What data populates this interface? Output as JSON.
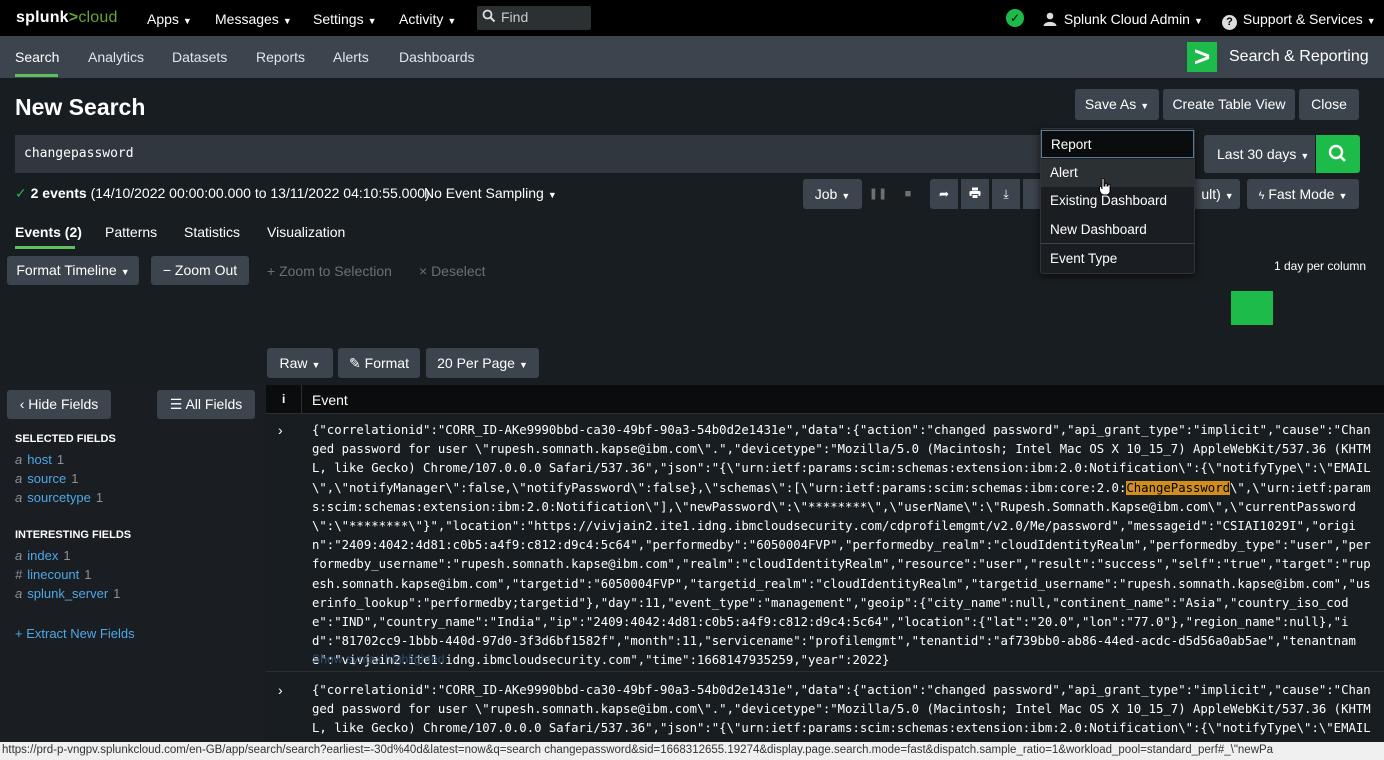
{
  "topbar": {
    "logo_prefix": "splunk",
    "logo_gt": ">",
    "logo_suffix": "cloud",
    "menus": [
      "Apps",
      "Messages",
      "Settings",
      "Activity"
    ],
    "find_placeholder": "Find",
    "user": "Splunk Cloud Admin",
    "support": "Support & Services"
  },
  "appbar": {
    "tabs": [
      "Search",
      "Analytics",
      "Datasets",
      "Reports",
      "Alerts",
      "Dashboards"
    ],
    "active_tab": "Search",
    "app_name": "Search & Reporting",
    "app_icon": ">"
  },
  "page": {
    "title": "New Search",
    "save_as": "Save As",
    "create_table": "Create Table View",
    "close": "Close"
  },
  "search": {
    "query": "changepassword",
    "time_range": "Last 30 days"
  },
  "status": {
    "count_text": "2 events",
    "range_text": "(14/10/2022 00:00:00.000 to 13/11/2022 04:10:55.000)",
    "sampling": "No Event Sampling",
    "job": "Job",
    "mode_partial": "ult)",
    "fast_mode": "Fast Mode"
  },
  "result_tabs": [
    "Events (2)",
    "Patterns",
    "Statistics",
    "Visualization"
  ],
  "timeline": {
    "format": "Format Timeline",
    "zoom_out": "Zoom Out",
    "zoom_sel": "+ Zoom to Selection",
    "deselect": "× Deselect",
    "per_column": "1 day per column"
  },
  "event_controls": {
    "raw": "Raw",
    "format": "Format",
    "per_page": "20 Per Page"
  },
  "sidebar": {
    "hide_fields": "Hide Fields",
    "all_fields": "All Fields",
    "selected_title": "SELECTED FIELDS",
    "selected": [
      {
        "type": "a",
        "name": "host",
        "count": "1"
      },
      {
        "type": "a",
        "name": "source",
        "count": "1"
      },
      {
        "type": "a",
        "name": "sourcetype",
        "count": "1"
      }
    ],
    "interesting_title": "INTERESTING FIELDS",
    "interesting": [
      {
        "type": "a",
        "name": "index",
        "count": "1"
      },
      {
        "type": "#",
        "name": "linecount",
        "count": "1"
      },
      {
        "type": "a",
        "name": "splunk_server",
        "count": "1"
      }
    ],
    "extract": "+ Extract New Fields"
  },
  "events_table": {
    "col_i": "i",
    "col_event": "Event",
    "event1_pre": "{\"correlationid\":\"CORR_ID-AKe9990bbd-ca30-49bf-90a3-54b0d2e1431e\",\"data\":{\"action\":\"changed password\",\"api_grant_type\":\"implicit\",\"cause\":\"Changed password for user \\\"rupesh.somnath.kapse@ibm.com\\\".\",\"devicetype\":\"Mozilla/5.0 (Macintosh; Intel Mac OS X 10_15_7) AppleWebKit/537.36 (KHTML, like Gecko) Chrome/107.0.0.0 Safari/537.36\",\"json\":\"{\\\"urn:ietf:params:scim:schemas:extension:ibm:2.0:Notification\\\":{\\\"notifyType\\\":\\\"EMAIL\\\",\\\"notifyManager\\\":false,\\\"notifyPassword\\\":false},\\\"schemas\\\":[\\\"urn:ietf:params:scim:schemas:ibm:core:2.0:",
    "event1_hl": "ChangePassword",
    "event1_post": "\\\",\\\"urn:ietf:params:scim:schemas:extension:ibm:2.0:Notification\\\"],\\\"newPassword\\\":\\\"********\\\",\\\"userName\\\":\\\"Rupesh.Somnath.Kapse@ibm.com\\\",\\\"currentPassword\\\":\\\"********\\\"}\",\"location\":\"https://vivjain2.ite1.idng.ibmcloudsecurity.com/cdprofilemgmt/v2.0/Me/password\",\"messageid\":\"CSIAI1029I\",\"origin\":\"2409:4042:4d81:c0b5:a4f9:c812:d9c4:5c64\",\"performedby\":\"6050004FVP\",\"performedby_realm\":\"cloudIdentityRealm\",\"performedby_type\":\"user\",\"performedby_username\":\"rupesh.somnath.kapse@ibm.com\",\"realm\":\"cloudIdentityRealm\",\"resource\":\"user\",\"result\":\"success\",\"self\":\"true\",\"target\":\"rupesh.somnath.kapse@ibm.com\",\"targetid\":\"6050004FVP\",\"targetid_realm\":\"cloudIdentityRealm\",\"targetid_username\":\"rupesh.somnath.kapse@ibm.com\",\"userinfo_lookup\":\"performedby;targetid\"},\"day\":11,\"event_type\":\"management\",\"geoip\":{\"city_name\":null,\"continent_name\":\"Asia\",\"country_iso_code\":\"IND\",\"country_name\":\"India\",\"ip\":\"2409:4042:4d81:c0b5:a4f9:c812:d9c4:5c64\",\"location\":{\"lat\":\"20.0\",\"lon\":\"77.0\"},\"region_name\":null},\"id\":\"81702cc9-1bbb-440d-97d0-3f3d6bf1582f\",\"month\":11,\"servicename\":\"profilemgmt\",\"tenantid\":\"af739bb0-ab86-44ed-acdc-d5d56a0ab5ae\",\"tenantname\":\"vivjain2.ite1.idng.ibmcloudsecurity.com\",\"time\":1668147935259,\"year\":2022}",
    "syntax_link": "Show syntax highlighted",
    "event2_pre": "{\"correlationid\":\"CORR_ID-AKe9990bbd-ca30-49bf-90a3-54b0d2e1431e\",\"data\":{\"action\":\"changed password\",\"api_grant_type\":\"implicit\",\"cause\":\"Changed password for user \\\"rupesh.somnath.kapse@ibm.com\\\".\",\"devicetype\":\"Mozilla/5.0 (Macintosh; Intel Mac OS X 10_15_7) AppleWebKit/537.36 (KHTML, like Gecko) Chrome/107.0.0.0 Safari/537.36\",\"json\":\"{\\\"urn:ietf:params:scim:schemas:extension:ibm:2.0:Notification\\\":{\\\"notifyType\\\":\\\"EMAIL\\\",\\\"notifyManager\\\":false,\\\"notifyPasswor"
  },
  "save_as_menu": {
    "items": [
      "Report",
      "Alert",
      "Existing Dashboard",
      "New Dashboard",
      "Event Type"
    ]
  },
  "status_bar_url": "https://prd-p-vngpv.splunkcloud.com/en-GB/app/search/search?earliest=-30d%40d&latest=now&q=search changepassword&sid=1668312655.19274&display.page.search.mode=fast&dispatch.sample_ratio=1&workload_pool=standard_perf#_\\\"newPa",
  "colors": {
    "accent_green": "#1dbb49",
    "highlight": "#d18e1b",
    "link_blue": "#4fa7e6"
  }
}
